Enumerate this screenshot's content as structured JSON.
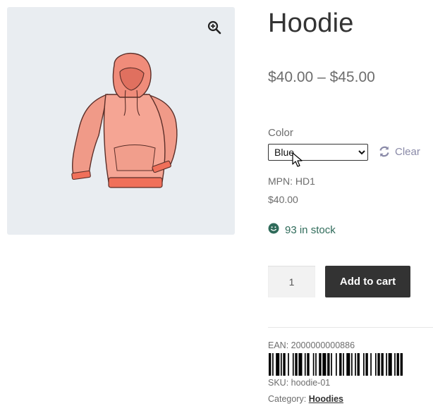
{
  "product": {
    "title": "Hoodie",
    "price_range": "$40.00 – $45.00",
    "image_alt": "hoodie-image"
  },
  "variation": {
    "attribute_label": "Color",
    "selected_option": "Blue",
    "clear_label": "Clear",
    "mpn": "MPN: HD1",
    "price": "$40.00",
    "stock": "93 in stock"
  },
  "cart": {
    "quantity": "1",
    "add_to_cart_label": "Add to cart"
  },
  "meta": {
    "ean": "EAN: 2000000000886",
    "sku": "SKU: hoodie-01",
    "category_label": "Category:",
    "category_link": "Hoodies"
  },
  "colors": {
    "button_bg": "#333333",
    "gallery_bg": "#e9edf1",
    "stock_icon": "#0f834d",
    "clear_link": "#8a8aa8"
  },
  "icons": {
    "zoom": "zoom-icon",
    "refresh": "refresh-icon",
    "stock": "smiley-icon",
    "cursor": "mouse-pointer-icon"
  }
}
